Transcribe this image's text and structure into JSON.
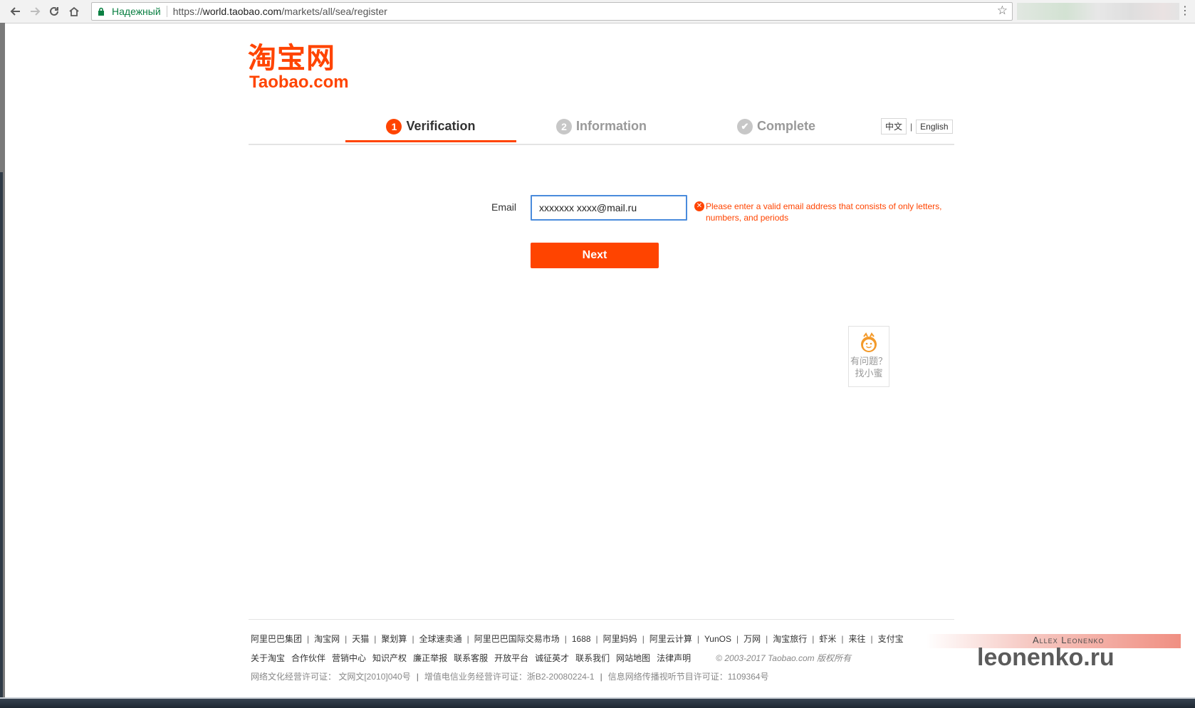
{
  "browser": {
    "secure_label": "Надежный",
    "url_prefix": "https://",
    "url_host": "world.taobao.com",
    "url_path": "/markets/all/sea/register",
    "back_icon": "back-arrow-icon",
    "forward_icon": "forward-arrow-icon",
    "reload_icon": "reload-icon",
    "home_icon": "home-icon",
    "bookmark_icon": "star-icon"
  },
  "logo": {
    "chinese": "淘宝网",
    "english": "Taobao.com",
    "color": "#ff4400"
  },
  "steps": [
    {
      "number": "1",
      "label": "Verification",
      "state": "active"
    },
    {
      "number": "2",
      "label": "Information",
      "state": "inactive"
    },
    {
      "number": "✔",
      "label": "Complete",
      "state": "inactive"
    }
  ],
  "language": {
    "chinese": "中文",
    "separator": "|",
    "english": "English"
  },
  "form": {
    "email_label": "Email",
    "email_value": "xxxxxxx xxxx@mail.ru",
    "error_message": "Please enter a valid email address that consists of only letters, numbers, and periods",
    "next_label": "Next"
  },
  "helper": {
    "line1": "有问题？",
    "line2": "找小蜜"
  },
  "footer": {
    "links_row1": [
      "阿里巴巴集团",
      "淘宝网",
      "天猫",
      "聚划算",
      "全球速卖通",
      "阿里巴巴国际交易市场",
      "1688",
      "阿里妈妈",
      "阿里云计算",
      "YunOS",
      "万网",
      "淘宝旅行",
      "虾米",
      "来往",
      "支付宝"
    ],
    "links_row2": [
      "关于淘宝",
      "合作伙伴",
      "营销中心",
      "知识产权",
      "廉正举报",
      "联系客服",
      "开放平台",
      "诚征英才",
      "联系我们",
      "网站地图",
      "法律声明"
    ],
    "copyright": "© 2003-2017 Taobao.com 版权所有",
    "license_row": [
      "网络文化经营许可证： 文网文[2010]040号",
      "增值电信业务经营许可证：浙B2-20080224-1",
      "信息网络传播视听节目许可证：1109364号"
    ]
  },
  "watermark": {
    "author": "Allex Leonenko",
    "site": "leonenko.ru"
  },
  "colors": {
    "accent": "#ff4400",
    "input_focus": "#4a8bdc",
    "inactive_step": "#c7c7c7"
  }
}
